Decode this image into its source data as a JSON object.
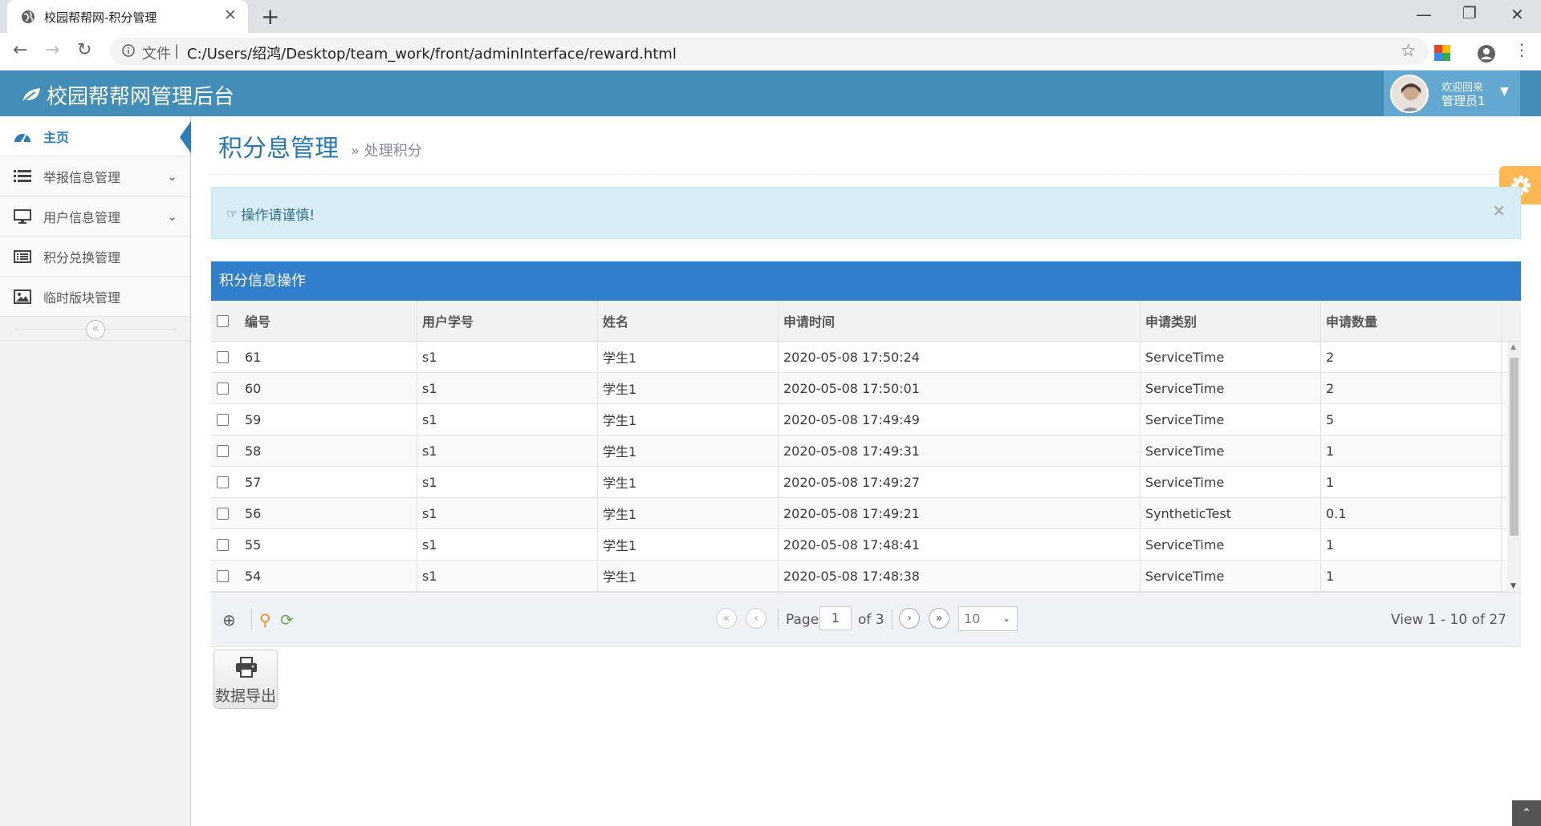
{
  "browser": {
    "tab_title": "校园帮帮网-积分管理",
    "url_protocol": "文件",
    "url_path": "C:/Users/绍鸿/Desktop/team_work/front/adminInterface/reward.html"
  },
  "header": {
    "brand": "校园帮帮网管理后台",
    "welcome": "欢迎回来",
    "username": "管理员1",
    "bg_color": "#438eb9"
  },
  "sidebar": {
    "items": [
      {
        "label": "主页",
        "icon": "dashboard-icon",
        "active": true
      },
      {
        "label": "举报信息管理",
        "icon": "list-icon",
        "has_submenu": true
      },
      {
        "label": "用户信息管理",
        "icon": "desktop-icon",
        "has_submenu": true
      },
      {
        "label": "积分兑换管理",
        "icon": "list-alt-icon"
      },
      {
        "label": "临时版块管理",
        "icon": "picture-icon"
      }
    ]
  },
  "page": {
    "title": "积分息管理",
    "subtitle": "处理积分",
    "alert": "操作请谨慎!"
  },
  "grid": {
    "caption": "积分信息操作",
    "columns": [
      "编号",
      "用户学号",
      "姓名",
      "申请时间",
      "申请类别",
      "申请数量"
    ],
    "rows": [
      [
        "61",
        "s1",
        "学生1",
        "2020-05-08 17:50:24",
        "ServiceTime",
        "2"
      ],
      [
        "60",
        "s1",
        "学生1",
        "2020-05-08 17:50:01",
        "ServiceTime",
        "2"
      ],
      [
        "59",
        "s1",
        "学生1",
        "2020-05-08 17:49:49",
        "ServiceTime",
        "5"
      ],
      [
        "58",
        "s1",
        "学生1",
        "2020-05-08 17:49:31",
        "ServiceTime",
        "1"
      ],
      [
        "57",
        "s1",
        "学生1",
        "2020-05-08 17:49:27",
        "ServiceTime",
        "1"
      ],
      [
        "56",
        "s1",
        "学生1",
        "2020-05-08 17:49:21",
        "SyntheticTest",
        "0.1"
      ],
      [
        "55",
        "s1",
        "学生1",
        "2020-05-08 17:48:41",
        "ServiceTime",
        "1"
      ],
      [
        "54",
        "s1",
        "学生1",
        "2020-05-08 17:48:38",
        "ServiceTime",
        "1"
      ]
    ],
    "caption_color": "#307ecc"
  },
  "pager": {
    "page_label": "Page",
    "page_value": "1",
    "of_label": "of 3",
    "rows_per_page": "10",
    "view_info": "View 1 - 10 of 27"
  },
  "export_button": "数据导出"
}
